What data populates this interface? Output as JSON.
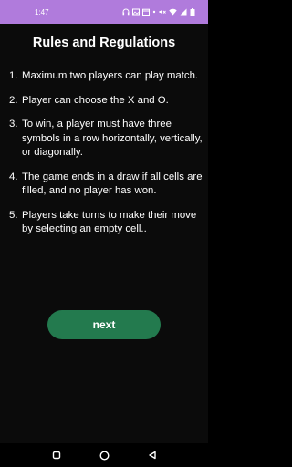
{
  "status_bar": {
    "time": "1:47",
    "icons": [
      "headset-icon",
      "gallery-icon",
      "calendar-icon",
      "dot-icon",
      "volume-off-icon",
      "wifi-icon",
      "signal-icon",
      "battery-icon"
    ]
  },
  "page": {
    "title": "Rules and Regulations",
    "rules": [
      {
        "number": "1.",
        "text": "Maximum two players can play match."
      },
      {
        "number": "2.",
        "text": "Player can choose the X and O."
      },
      {
        "number": "3.",
        "text": "To win, a player must have three symbols in a row horizontally, vertically, or diagonally."
      },
      {
        "number": "4.",
        "text": "The game ends in a draw if all cells are filled, and no player has won."
      },
      {
        "number": "5.",
        "text": "Players take turns to make their move by selecting an empty cell.."
      }
    ],
    "next_label": "next"
  },
  "colors": {
    "status_bar": "#b07bdc",
    "background": "#0b0b0b",
    "button": "#237a4e",
    "text": "#ffffff"
  },
  "nav_bar": {
    "icons": [
      "recent-apps-icon",
      "home-icon",
      "back-icon"
    ]
  }
}
